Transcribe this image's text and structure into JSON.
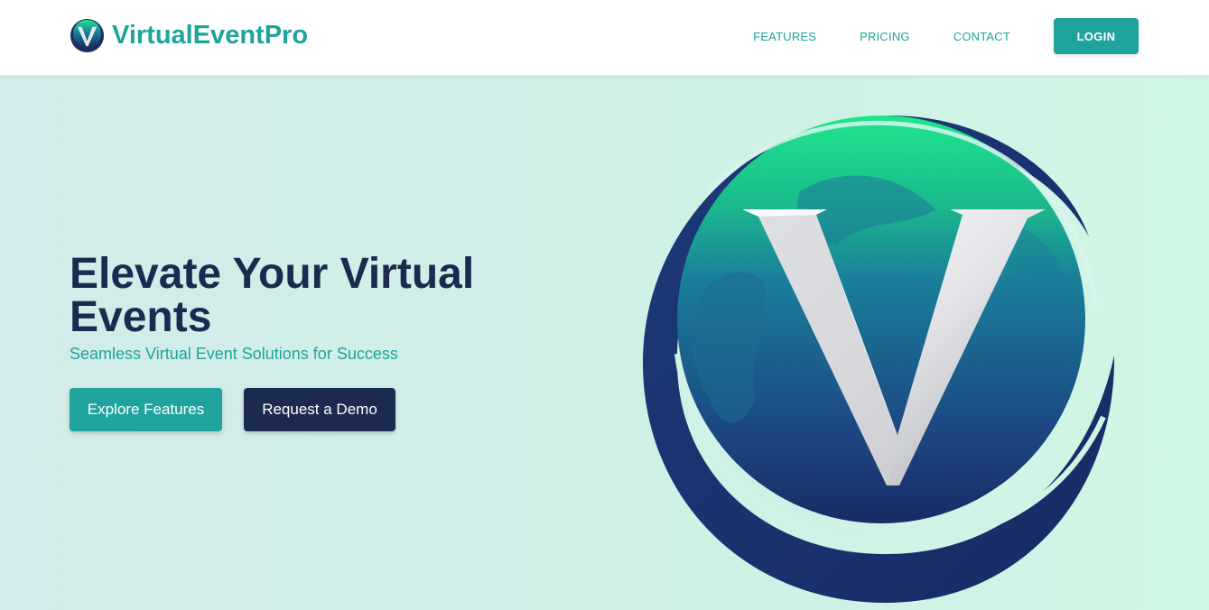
{
  "brand": {
    "name": "VirtualEventPro",
    "logo_icon": "globe-v-logo-icon"
  },
  "nav": {
    "links": [
      "FEATURES",
      "PRICING",
      "CONTACT"
    ],
    "login_label": "LOGIN"
  },
  "hero": {
    "title": "Elevate Your Virtual Events",
    "subtitle": "Seamless Virtual Event Solutions for Success",
    "primary_button": "Explore Features",
    "secondary_button": "Request a Demo",
    "illustration": "globe-v-logo-icon"
  },
  "colors": {
    "accent": "#1fa39d",
    "navy": "#1d2a4f",
    "hero_bg_start": "#d3ebea",
    "hero_bg_end": "#d0f6e4",
    "globe_green": "#1ee68a"
  }
}
